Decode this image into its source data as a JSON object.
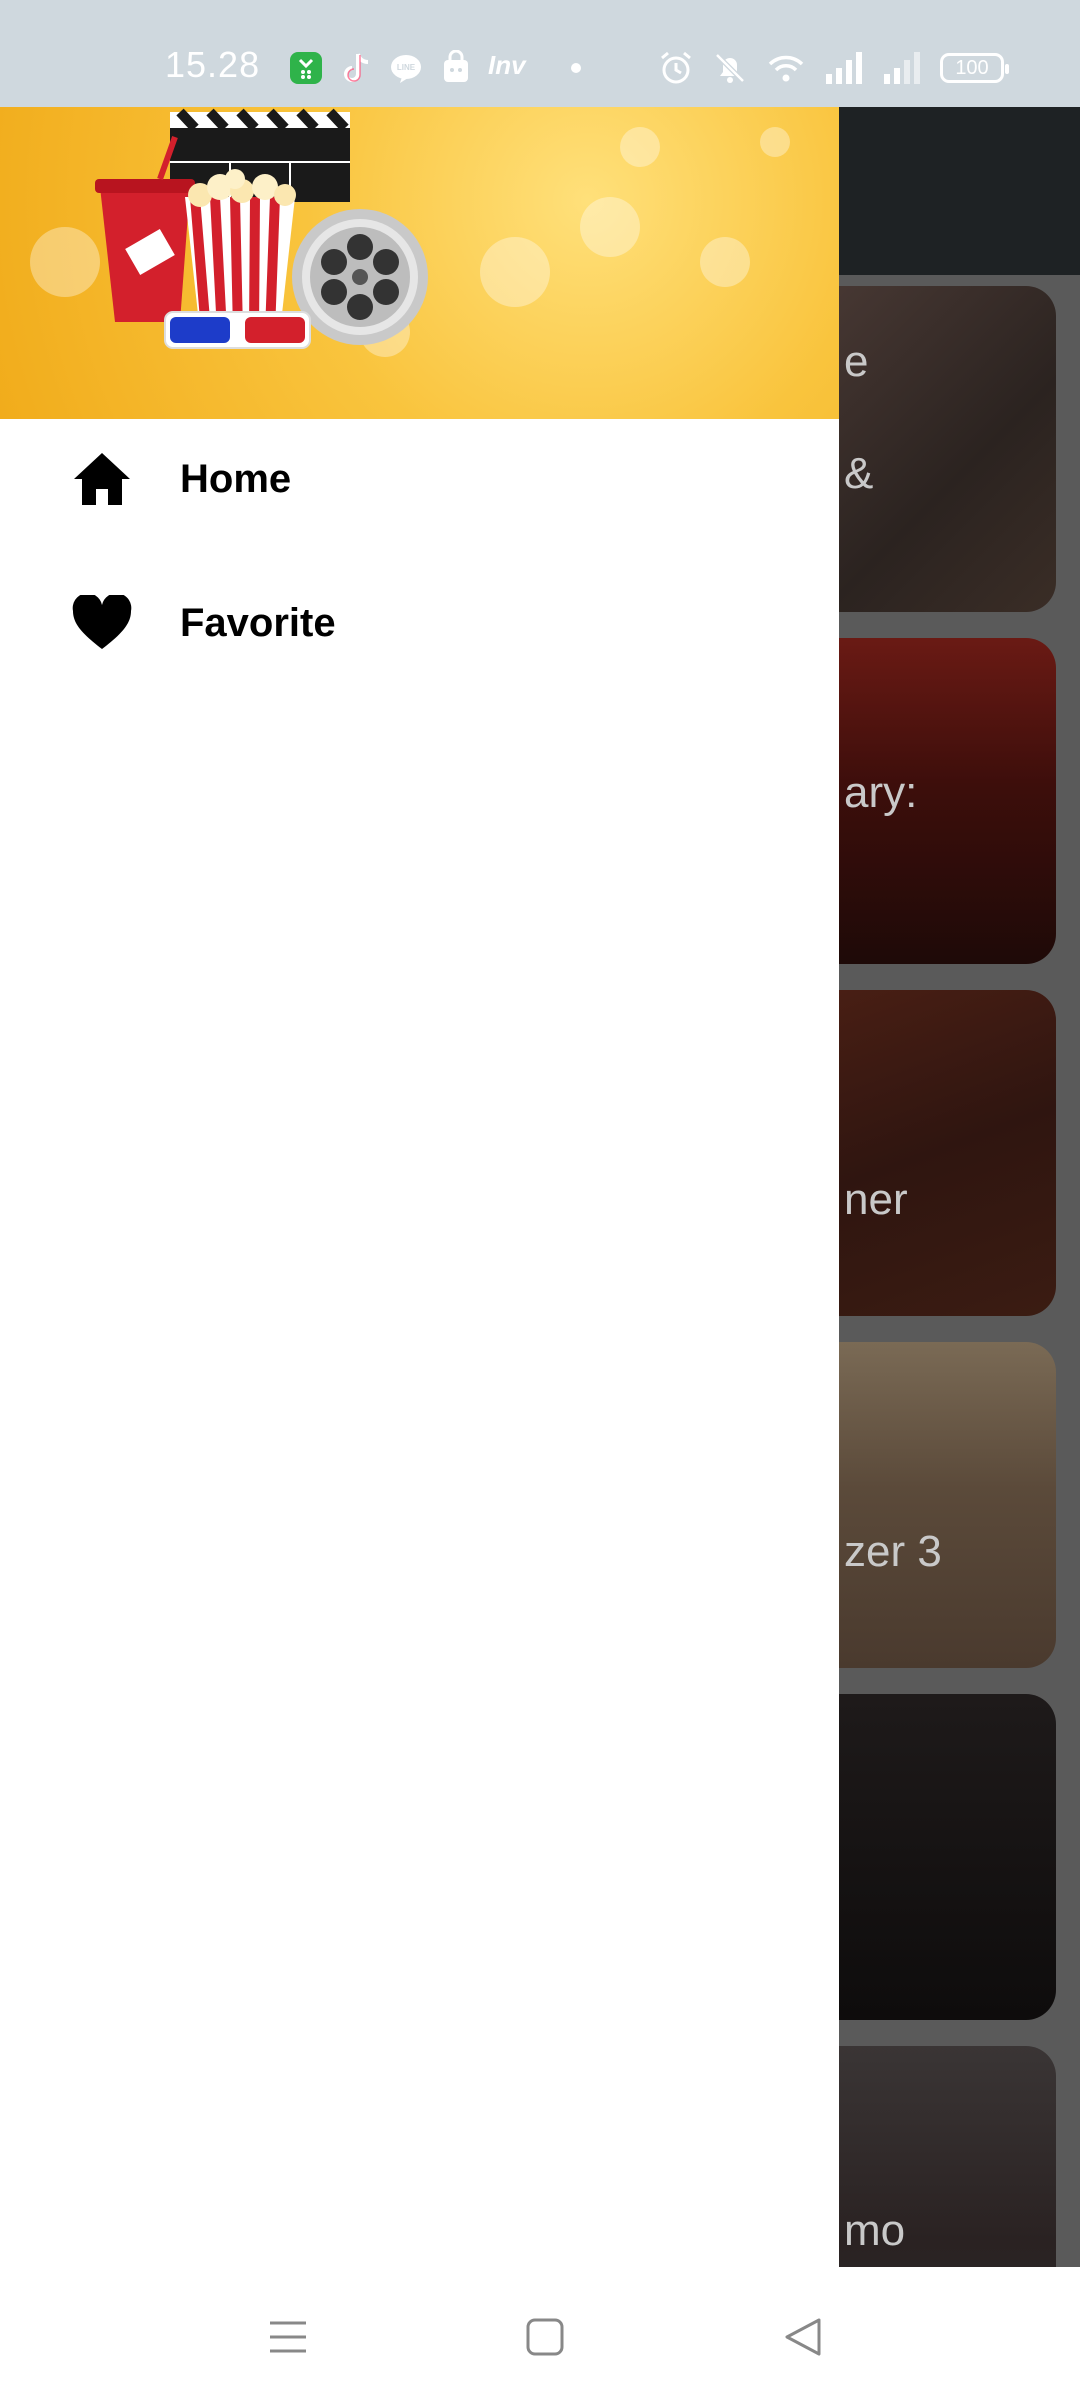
{
  "status_bar": {
    "time": "15.28",
    "battery": "100",
    "left_icons": [
      "app-store-icon",
      "tiktok-icon",
      "line-icon",
      "bag-icon",
      "inv-icon",
      "dot-icon"
    ],
    "right_icons": [
      "alarm-icon",
      "bell-off-icon",
      "wifi-icon",
      "signal-icon",
      "signal-icon-2"
    ],
    "inv_label": "Inv"
  },
  "drawer": {
    "header_image": "cinema-header-image",
    "menu": [
      {
        "label": "Home",
        "icon": "home-icon"
      },
      {
        "label": "Favorite",
        "icon": "heart-icon"
      }
    ]
  },
  "background_list": {
    "cards": [
      {
        "label": "e\n&"
      },
      {
        "label": "ary:"
      },
      {
        "label": "ner"
      },
      {
        "label": "zer 3"
      },
      {
        "label": ""
      },
      {
        "label": "mo"
      }
    ]
  },
  "navigation_bar": {
    "buttons": [
      "menu-icon",
      "home-square-icon",
      "back-icon"
    ]
  },
  "colors": {
    "status_bar": "#cfd8de",
    "drawer_header_accent": "#f9c43d",
    "drawer_bg": "#ffffff",
    "scrim": "#5a5a5a"
  }
}
